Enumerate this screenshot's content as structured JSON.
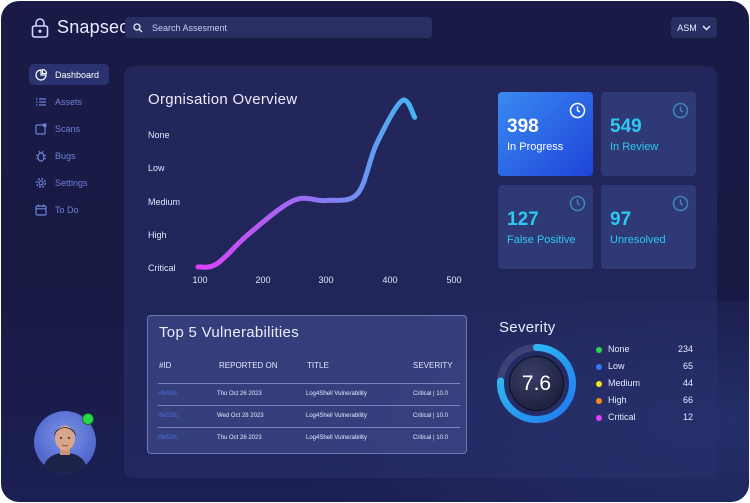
{
  "brand": {
    "name": "Snapsec"
  },
  "search": {
    "placeholder": "Search Assesment"
  },
  "account_menu": {
    "label": "ASM"
  },
  "sidebar": {
    "items": [
      {
        "label": "Dashboard",
        "icon": "dashboard-icon",
        "active": true
      },
      {
        "label": "Assets",
        "icon": "list-icon",
        "active": false
      },
      {
        "label": "Scans",
        "icon": "scan-icon",
        "active": false
      },
      {
        "label": "Bugs",
        "icon": "bug-icon",
        "active": false
      },
      {
        "label": "Settings",
        "icon": "gear-icon",
        "active": false
      },
      {
        "label": "To Do",
        "icon": "calendar-icon",
        "active": false
      }
    ]
  },
  "overview": {
    "title": "Orgnisation Overview",
    "chart_data": {
      "type": "line",
      "title": "Orgnisation Overview",
      "y_categories": [
        "None",
        "Low",
        "Medium",
        "High",
        "Critical"
      ],
      "x_ticks": [
        "100",
        "200",
        "300",
        "400",
        "500"
      ],
      "x": [
        100,
        130,
        180,
        250,
        300,
        350,
        380,
        420,
        440
      ],
      "y": [
        "Critical",
        "Critical",
        "High",
        "Medium",
        "Medium",
        "Medium",
        "Low",
        "None",
        "None"
      ],
      "ylevels": [
        0,
        0.1,
        1,
        2,
        2,
        2.2,
        3.7,
        5,
        4.5
      ],
      "grid": false,
      "colors": [
        "#e040fb",
        "#2fc8f0"
      ]
    }
  },
  "stats": [
    {
      "value": "398",
      "label": "In Progress",
      "highlight": true
    },
    {
      "value": "549",
      "label": "In Review",
      "highlight": false
    },
    {
      "value": "127",
      "label": "False Positive",
      "highlight": false
    },
    {
      "value": "97",
      "label": "Unresolved",
      "highlight": false
    }
  ],
  "vulnerabilities": {
    "title": "Top 5 Vulnerabilities",
    "columns": [
      "#ID",
      "REPORTED ON",
      "TITLE",
      "SEVERITY"
    ],
    "rows": [
      {
        "id": "#fe52fc",
        "reported_on": "Thu Oct 26 2023",
        "title": "Log4Shell Vulnerability",
        "severity": "Critical | 10.0"
      },
      {
        "id": "#fe52fc",
        "reported_on": "Wed Oct 28 2023",
        "title": "Log4Shell Vulnerability",
        "severity": "Critical | 10.0"
      },
      {
        "id": "#fe52fc",
        "reported_on": "Thu Oct 26 2023",
        "title": "Log4Shell Vulnerability",
        "severity": "Critical | 10.0"
      }
    ]
  },
  "severity": {
    "title": "Severity",
    "score": "7.6",
    "score_fraction": 0.76,
    "legend": [
      {
        "name": "None",
        "count": "234",
        "color": "#27d94a"
      },
      {
        "name": "Low",
        "count": "65",
        "color": "#2f7cf6"
      },
      {
        "name": "Medium",
        "count": "44",
        "color": "#f5e12a"
      },
      {
        "name": "High",
        "count": "66",
        "color": "#f58a1f"
      },
      {
        "name": "Critical",
        "count": "12",
        "color": "#e040fb"
      }
    ]
  },
  "user": {
    "status": "online",
    "status_color": "#27d94a"
  }
}
